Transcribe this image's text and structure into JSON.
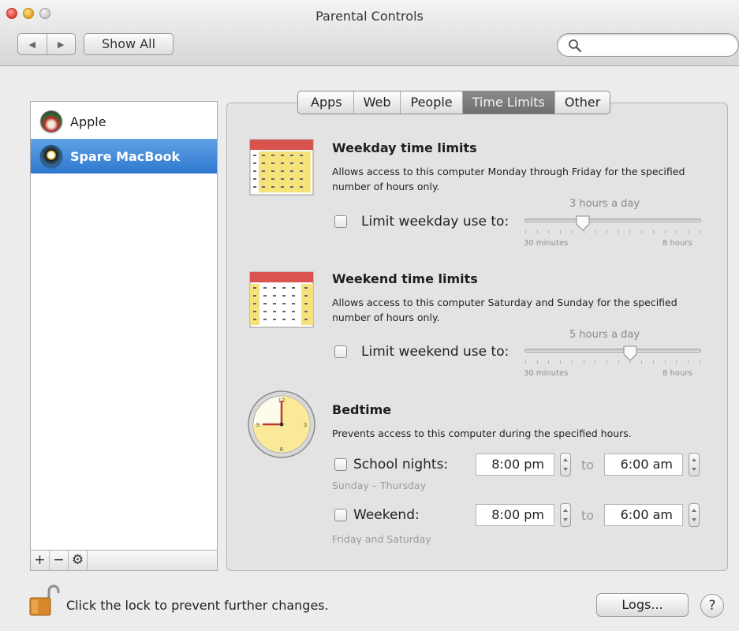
{
  "window": {
    "title": "Parental Controls"
  },
  "toolbar": {
    "back_icon": "◀",
    "forward_icon": "▶",
    "show_all_label": "Show All",
    "search_placeholder": "",
    "search_value": ""
  },
  "sidebar": {
    "users": [
      {
        "name": "Apple",
        "selected": false
      },
      {
        "name": "Spare MacBook",
        "selected": true
      }
    ],
    "tools": [
      "+",
      "−",
      "⚙"
    ]
  },
  "tabs": [
    {
      "label": "Apps",
      "selected": false
    },
    {
      "label": "Web",
      "selected": false
    },
    {
      "label": "People",
      "selected": false
    },
    {
      "label": "Time Limits",
      "selected": true
    },
    {
      "label": "Other",
      "selected": false
    }
  ],
  "weekday": {
    "title": "Weekday time limits",
    "description": "Allows access to this computer Monday through Friday for the specified number of hours only.",
    "checkbox_label": "Limit weekday use to:",
    "checked": false,
    "value_label": "3 hours a day",
    "min_label": "30 minutes",
    "max_label": "8 hours",
    "fraction": 0.33
  },
  "weekend": {
    "title": "Weekend time limits",
    "description": "Allows access to this computer Saturday and Sunday for the specified number of hours only.",
    "checkbox_label": "Limit weekend use to:",
    "checked": false,
    "value_label": "5 hours a day",
    "min_label": "30 minutes",
    "max_label": "8 hours",
    "fraction": 0.6
  },
  "bedtime": {
    "title": "Bedtime",
    "description": "Prevents access to this computer during the specified hours.",
    "school": {
      "label": "School nights:",
      "checked": false,
      "note": "Sunday – Thursday",
      "from": "8:00 pm",
      "to_word": "to",
      "to": "6:00 am"
    },
    "weekend": {
      "label": "Weekend:",
      "checked": false,
      "note": "Friday and Saturday",
      "from": "8:00 pm",
      "to_word": "to",
      "to": "6:00 am"
    }
  },
  "footer": {
    "lock_text": "Click the lock to prevent further changes.",
    "logs_label": "Logs...",
    "help_label": "?"
  },
  "icons": {
    "close": "close-button-icon",
    "minimize": "minimize-button-icon",
    "zoom": "zoom-button-icon",
    "search": "search-icon",
    "calendar": "calendar-icon",
    "clock": "clock-icon",
    "lock": "unlocked-padlock-icon"
  },
  "colors": {
    "selection": "#3b83d6",
    "tab_selected": "#7d7d7d",
    "calendar_header": "#d9534f",
    "calendar_body": "#f5e27a",
    "clock_face": "#fbe99a"
  }
}
